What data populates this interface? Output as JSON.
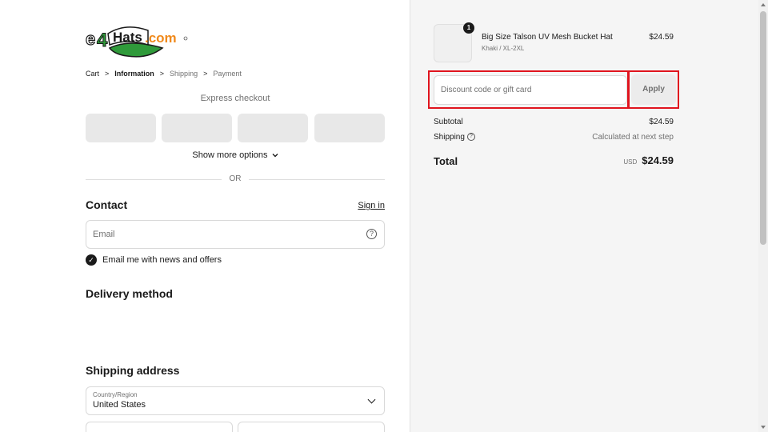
{
  "logo": {
    "text_e": "e",
    "text_4": "4",
    "text_hats": "Hats",
    "text_com": ".com"
  },
  "breadcrumb": {
    "items": [
      "Cart",
      "Information",
      "Shipping",
      "Payment"
    ],
    "separator": ">"
  },
  "express": {
    "label": "Express checkout",
    "show_more": "Show more options"
  },
  "divider": {
    "or": "OR"
  },
  "contact": {
    "heading": "Contact",
    "sign_in": "Sign in",
    "email_placeholder": "Email",
    "newsletter_label": "Email me with news and offers",
    "newsletter_checked": true
  },
  "delivery": {
    "heading": "Delivery method"
  },
  "shipping_address": {
    "heading": "Shipping address",
    "country_label": "Country/Region",
    "country_value": "United States"
  },
  "order": {
    "item": {
      "name": "Big Size Talson UV Mesh Bucket Hat",
      "variant": "Khaki / XL-2XL",
      "price": "$24.59",
      "quantity": "1"
    },
    "discount_placeholder": "Discount code or gift card",
    "apply_label": "Apply",
    "subtotal_label": "Subtotal",
    "subtotal_value": "$24.59",
    "shipping_label": "Shipping",
    "shipping_value": "Calculated at next step",
    "total_label": "Total",
    "total_currency": "USD",
    "total_value": "$24.59"
  },
  "colors": {
    "highlight": "#e0141e",
    "brand_orange": "#f08a1c",
    "brand_green": "#2f9a3a"
  }
}
